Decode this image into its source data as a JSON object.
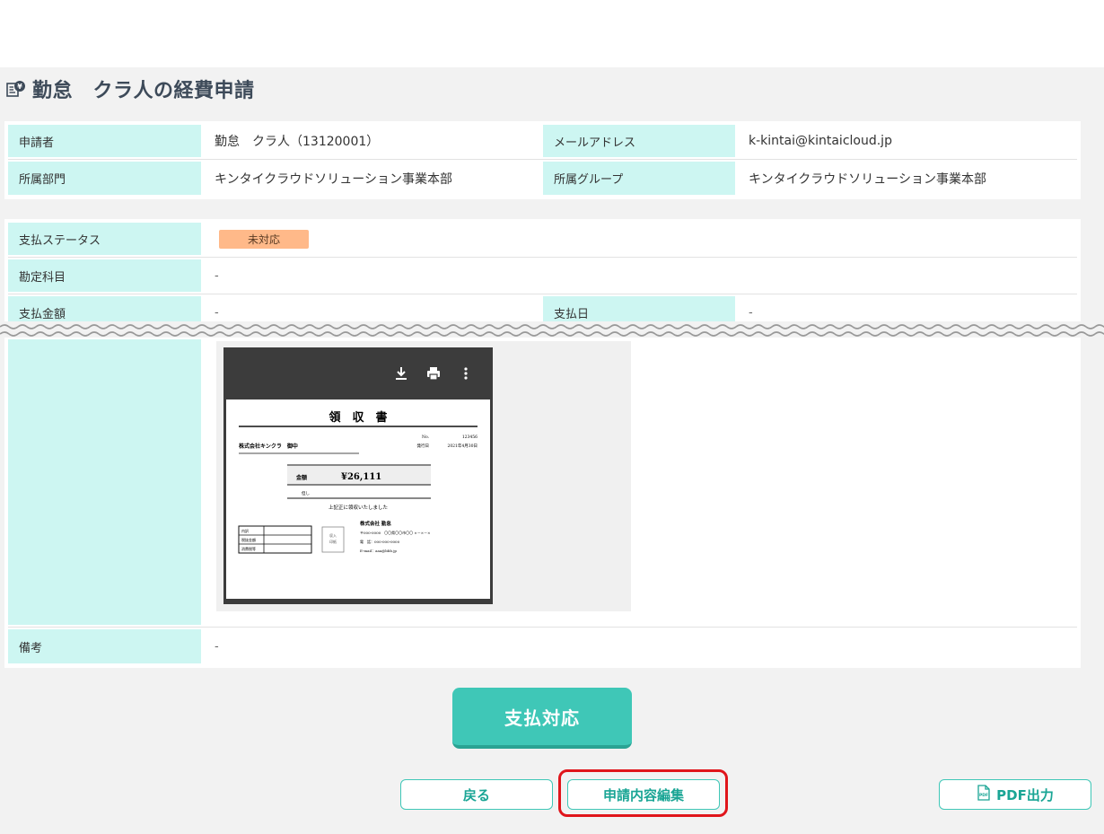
{
  "page": {
    "title": "勤怠　クラ人の経費申請"
  },
  "applicant_info": {
    "applicant_label": "申請者",
    "applicant_value": "勤怠　クラ人（13120001）",
    "email_label": "メールアドレス",
    "email_value": "k-kintai@kintaicloud.jp",
    "department_label": "所属部門",
    "department_value": "キンタイクラウドソリューション事業本部",
    "group_label": "所属グループ",
    "group_value": "キンタイクラウドソリューション事業本部"
  },
  "payment": {
    "status_label": "支払ステータス",
    "status_value": "未対応",
    "status_color": "#ffb989",
    "account_label": "勘定科目",
    "account_value": "-",
    "amount_label": "支払金額",
    "amount_value": "-",
    "date_label": "支払日",
    "date_value": "-"
  },
  "receipt": {
    "title": "領　収　書",
    "no_label": "No.",
    "no_value": "123456",
    "issue_label": "発行日",
    "issue_date": "2021年4月30日",
    "addressee": "株式会社キンクラ　御中",
    "amount_label": "金額",
    "amount_value": "¥26,111",
    "note_label": "但し",
    "received_text": "上記正に領収いたしました",
    "breakdown": [
      "内訳",
      "税抜金額",
      "消費税等"
    ],
    "stamp_text": [
      "収入",
      "印紙"
    ],
    "company_name": "株式会社 勤怠",
    "company_address": "〒000-0000　〇〇県〇〇市〇〇 ×－×－×",
    "company_phone": "電　話：000-000-0000",
    "company_email": "E-mail：aaa@bbb.jp"
  },
  "remarks": {
    "label": "備考",
    "value": "-"
  },
  "actions": {
    "pay_label": "支払対応",
    "back_label": "戻る",
    "edit_label": "申請内容編集",
    "pdf_label": "PDF出力",
    "pdf_icon_text": "PDF"
  },
  "colors": {
    "accent": "#3fc7b7",
    "label_bg": "#cdf6f2",
    "highlight": "#e0151b"
  }
}
